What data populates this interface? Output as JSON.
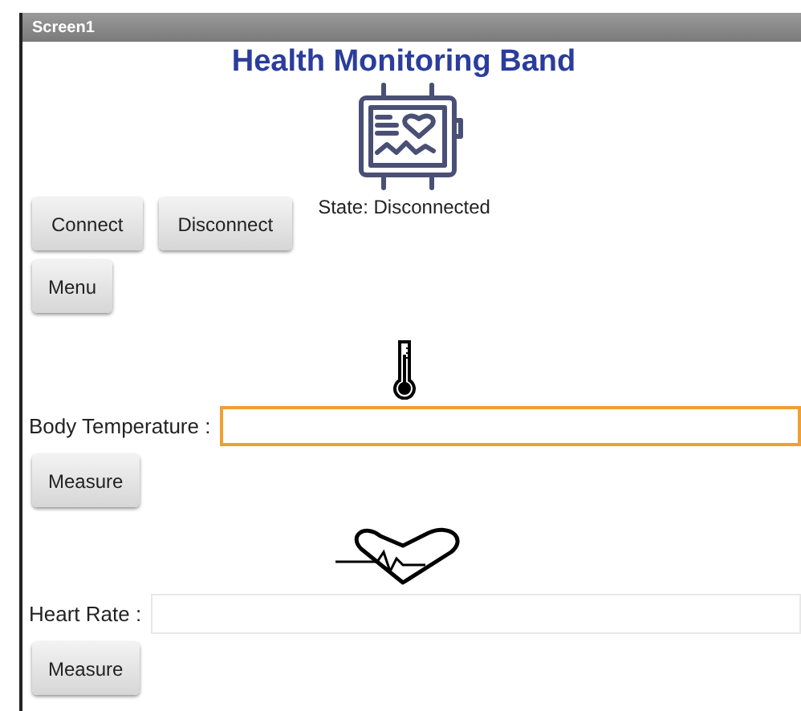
{
  "window": {
    "title": "Screen1"
  },
  "heading": "Health Monitoring Band",
  "connection": {
    "buttons": [
      "Connect",
      "Disconnect"
    ],
    "state": "State: Disconnected"
  },
  "menu_button": "Menu",
  "measurements": [
    {
      "kind": "temperature",
      "label": "Body Temperature :",
      "focused": true,
      "button": "Measure"
    },
    {
      "kind": "heart",
      "label": "Heart Rate :",
      "focused": false,
      "button": "Measure"
    }
  ]
}
